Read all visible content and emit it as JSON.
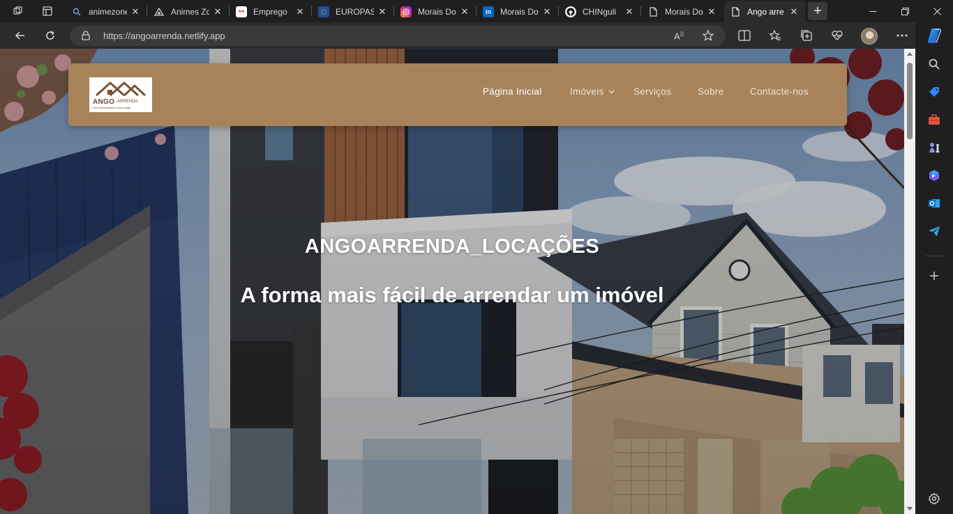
{
  "browser": {
    "tabs": [
      {
        "title": "animezone",
        "icon": "search-icon",
        "color": "#3c3c3c"
      },
      {
        "title": "Animes Zone",
        "icon": "triangle-logo-icon",
        "color": "#3c3c3c"
      },
      {
        "title": "Emprego",
        "icon": "job-site-icon",
        "color": "#c0392b"
      },
      {
        "title": "EUROPASS",
        "icon": "europass-icon",
        "color": "#1f4e9c"
      },
      {
        "title": "Morais Do",
        "icon": "instagram-icon",
        "color": "#d62976"
      },
      {
        "title": "Morais Do",
        "icon": "linkedin-icon",
        "color": "#0a66c2"
      },
      {
        "title": "CHINguli",
        "icon": "github-icon",
        "color": "#111111"
      },
      {
        "title": "Morais Do",
        "icon": "page-icon",
        "color": "#3c3c3c"
      },
      {
        "title": "Ango arre",
        "icon": "page-icon",
        "color": "#3c3c3c",
        "active": true
      }
    ],
    "new_tab_label": "+",
    "url": "https://angoarrenda.netlify.app"
  },
  "site": {
    "logo": {
      "brand": "ANGO",
      "brand2": "ARRENDA",
      "slogan": "Seu intermediário e seu amigo"
    },
    "menu": {
      "home": "Página Inicial",
      "properties": "Imóveis",
      "services": "Serviços",
      "about": "Sobre",
      "contact": "Contacte-nos"
    },
    "hero": {
      "title": "ANGOARRENDA_LOCAÇÕES",
      "subtitle": "A forma mais fácil de arrendar um imóvel"
    }
  },
  "colors": {
    "header": "#a8835a",
    "sky": "#7a8ea6",
    "accent_edge": "#1f6fd1"
  }
}
